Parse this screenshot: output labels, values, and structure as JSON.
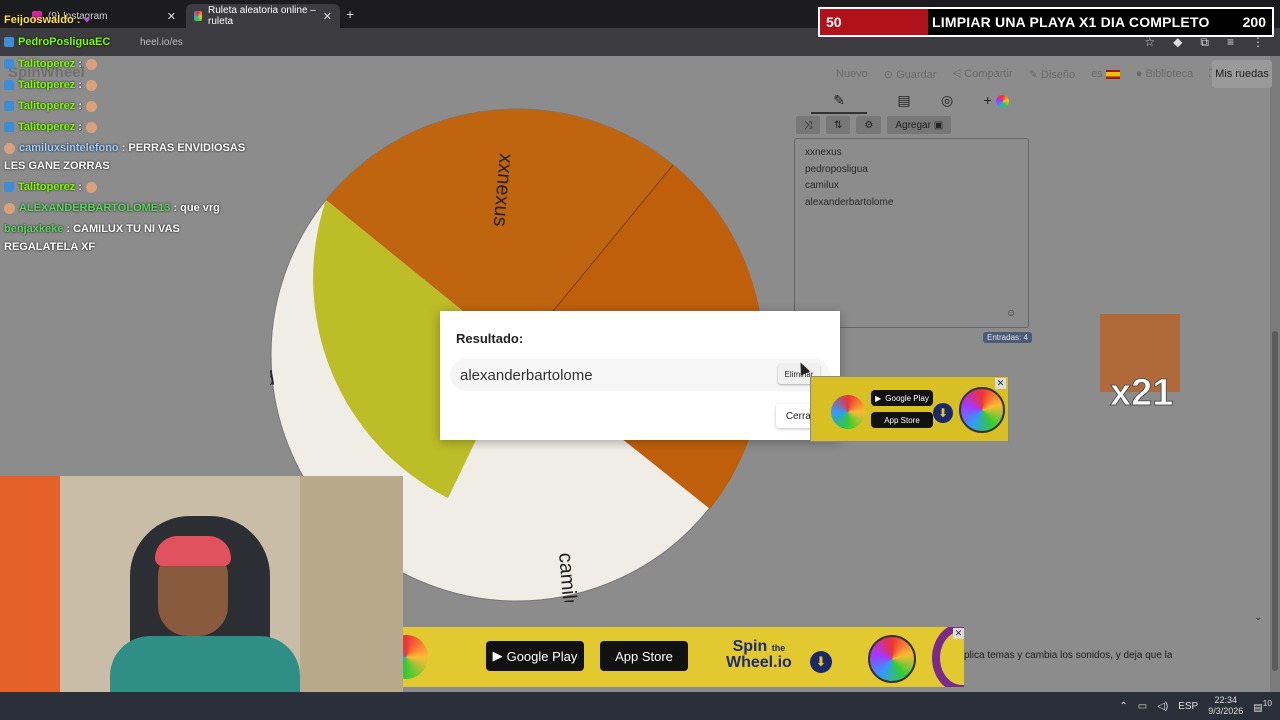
{
  "browser": {
    "tab1_label": "(9) Instagram",
    "tab2_label": "Ruleta aleatoria online – ruleta",
    "url_fragment": "heel.io/es"
  },
  "banner": {
    "left_number": "50",
    "text": "LIMPIAR UNA PLAYA X1 DIA COMPLETO",
    "right_number": "200"
  },
  "site": {
    "brand": "SpinWheel",
    "nav": [
      "Nuevo",
      "Guardar",
      "Compartir",
      "Diseño",
      "es",
      "Biblioteca"
    ],
    "my_wheels": "Mis ruedas",
    "add_label": "Agregar",
    "entries": [
      "xxnexus",
      "pedroposligua",
      "camilux",
      "alexanderbartolome"
    ],
    "entries_count": "Entradas: 4"
  },
  "wheel": {
    "labels": [
      "xxnexus",
      "pedroposligua",
      "camilux"
    ],
    "colors": {
      "orange": "#c0650f",
      "yellow": "#bdbd28",
      "light": "#f0ede7",
      "shadow": "#bf5f0c"
    }
  },
  "chat": {
    "l1_user": "Feijooswaldo",
    "l1_sep": ":",
    "l2_user": "PedroPosliguaEC",
    "user_talito": "Talitoperez",
    "sep": ":",
    "camilux_user": "camiluxsintelefono",
    "camilux_msg": ": PERRAS ENVIDIOSAS",
    "camilux_msg2": "LES GANE ZORRAS",
    "alex_user": "ALEXANDERBARTOLOME13",
    "alex_msg": ": que vrg",
    "benja_user": "benjaxkeke",
    "benja_msg": ": CAMILUX TU NI VAS",
    "benja_msg2": "REGALATELA XF"
  },
  "modal": {
    "title": "Resultado:",
    "result": "alexanderbartolome",
    "remove_label": "Eliminar",
    "close_label": "Cerrar"
  },
  "ads": {
    "google_play": "Google Play",
    "app_store": "App Store",
    "spin": "Spin",
    "the": "the",
    "wheel_io": "Wheel.io"
  },
  "description_partial": "plica temas y cambia los sonidos, y deja que la",
  "overlay": {
    "multiplier": "x21"
  },
  "taskbar": {
    "lang": "ESP",
    "time": "22:34",
    "date": "9/3/2026",
    "notif_count": "10"
  }
}
